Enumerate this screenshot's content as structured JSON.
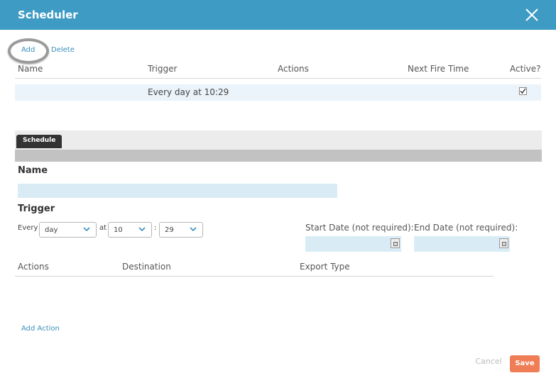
{
  "dialog": {
    "title": "Scheduler"
  },
  "toolbar": {
    "add_label": "Add",
    "delete_label": "Delete"
  },
  "table": {
    "headers": [
      "Name",
      "Trigger",
      "Actions",
      "Next Fire Time",
      "Active?"
    ],
    "rows": [
      {
        "name": "",
        "trigger": "Every day at 10:29",
        "actions": "",
        "next_fire_time": "",
        "active": true
      }
    ]
  },
  "schedule_tab": {
    "label": "Schedule"
  },
  "form": {
    "name_label": "Name",
    "name_value": "",
    "trigger_label": "Trigger",
    "every_label": "Every",
    "every_value": "day",
    "at_label": "at",
    "hour_value": "10",
    "colon": ":",
    "minute_value": "29",
    "start_date_label": "Start Date (not required):",
    "end_date_label": "End Date (not required):"
  },
  "actions_table": {
    "headers": [
      "Actions",
      "Destination",
      "Export Type"
    ]
  },
  "add_action_label": "Add Action",
  "footer": {
    "cancel_label": "Cancel",
    "save_label": "Save"
  },
  "colors": {
    "header": "#3d9bc4",
    "link": "#3a8fbd",
    "save": "#ef7e57",
    "input_bg": "#d9ecf5"
  },
  "icons": [
    "close-icon",
    "chevron-down-icon",
    "calendar-icon",
    "checkbox-checked-icon"
  ]
}
